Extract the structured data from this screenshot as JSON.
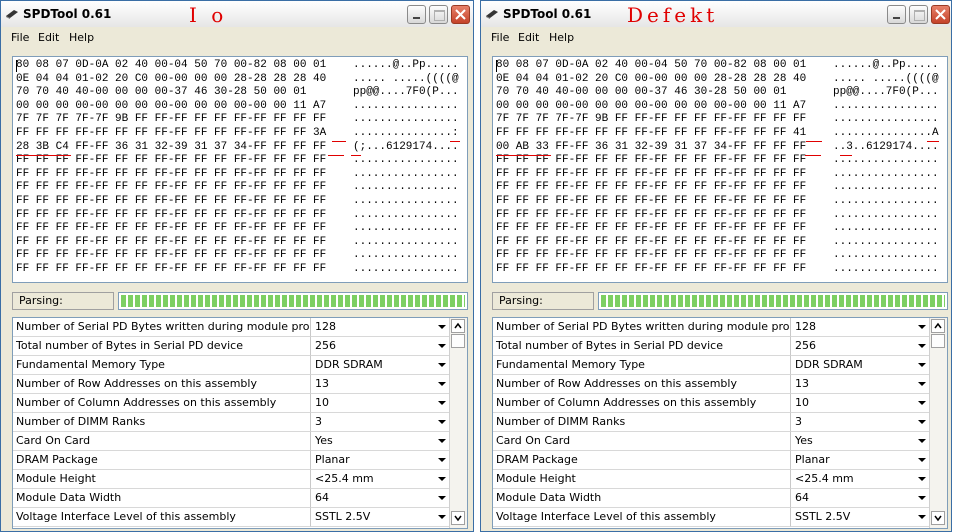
{
  "windows": [
    {
      "title": "SPDTool 0.61",
      "annotation": "I o",
      "menu": [
        "File",
        "Edit",
        "Help"
      ],
      "hex_rows": [
        {
          "hex": "80 08 07 0D-0A 02 40 00-04 50 70 00-82 08 00 01",
          "ascii": "......@..Pp....."
        },
        {
          "hex": "0E 04 04 01-02 20 C0 00-00 00 00 28-28 28 28 40",
          "ascii": "..... .....((((@"
        },
        {
          "hex": "70 70 40 40-00 00 00 00-37 46 30-28 50 00 01",
          "ascii": "pp@@....7F0(P..."
        },
        {
          "hex": "00 00 00 00-00 00 00 00-00 00 00 00-00 00 11 A7",
          "ascii": "................"
        },
        {
          "hex": "7F 7F 7F 7F-7F 9B FF FF-FF FF FF FF-FF FF FF FF",
          "ascii": "................"
        },
        {
          "hex": "FF FF FF FF-FF FF FF FF-FF FF FF FF-FF FF FF 3A",
          "ascii": "...............:"
        },
        {
          "hex": "28 3B C4 FF-FF 36 31 32-39 31 37 34-FF FF FF FF",
          "ascii": "(;...6129174...."
        },
        {
          "hex": "FF FF FF FF-FF FF FF FF-FF FF FF FF-FF FF FF FF",
          "ascii": "................"
        },
        {
          "hex": "FF FF FF FF-FF FF FF FF-FF FF FF FF-FF FF FF FF",
          "ascii": "................"
        },
        {
          "hex": "FF FF FF FF-FF FF FF FF-FF FF FF FF-FF FF FF FF",
          "ascii": "................"
        },
        {
          "hex": "FF FF FF FF-FF FF FF FF-FF FF FF FF-FF FF FF FF",
          "ascii": "................"
        },
        {
          "hex": "FF FF FF FF-FF FF FF FF-FF FF FF FF-FF FF FF FF",
          "ascii": "................"
        },
        {
          "hex": "FF FF FF FF-FF FF FF FF-FF FF FF FF-FF FF FF FF",
          "ascii": "................"
        },
        {
          "hex": "FF FF FF FF-FF FF FF FF-FF FF FF FF-FF FF FF FF",
          "ascii": "................"
        },
        {
          "hex": "FF FF FF FF-FF FF FF FF-FF FF FF FF-FF FF FF FF",
          "ascii": "................"
        },
        {
          "hex": "FF FF FF FF-FF FF FF FF-FF FF FF FF-FF FF FF FF",
          "ascii": "................"
        }
      ],
      "parsing_label": "Parsing:",
      "parsing_progress": 1.0,
      "fields": [
        {
          "name": "Number of Serial PD Bytes written during module production",
          "value": "128"
        },
        {
          "name": "Total number of Bytes in Serial PD device",
          "value": "256"
        },
        {
          "name": "Fundamental Memory Type",
          "value": "DDR SDRAM"
        },
        {
          "name": "Number of Row Addresses on this assembly",
          "value": "13"
        },
        {
          "name": "Number of Column Addresses on this assembly",
          "value": "10"
        },
        {
          "name": "Number of DIMM Ranks",
          "value": "3"
        },
        {
          "name": "Card On Card",
          "value": "Yes"
        },
        {
          "name": "DRAM Package",
          "value": "Planar"
        },
        {
          "name": "Module Height",
          "value": "<25.4 mm"
        },
        {
          "name": "Module Data Width",
          "value": "64"
        },
        {
          "name": "Voltage Interface Level of this assembly",
          "value": "SSTL 2.5V"
        }
      ]
    },
    {
      "title": "SPDTool 0.61",
      "annotation": "Defekt",
      "menu": [
        "File",
        "Edit",
        "Help"
      ],
      "hex_rows": [
        {
          "hex": "80 08 07 0D-0A 02 40 00-04 50 70 00-82 08 00 01",
          "ascii": "......@..Pp....."
        },
        {
          "hex": "0E 04 04 01-02 20 C0 00-00 00 00 28-28 28 28 40",
          "ascii": "..... .....((((@"
        },
        {
          "hex": "70 70 40 40-00 00 00 00-37 46 30-28 50 00 01",
          "ascii": "pp@@....7F0(P..."
        },
        {
          "hex": "00 00 00 00-00 00 00 00-00 00 00 00-00 00 11 A7",
          "ascii": "................"
        },
        {
          "hex": "7F 7F 7F 7F-7F 9B FF FF-FF FF FF FF-FF FF FF FF",
          "ascii": "................"
        },
        {
          "hex": "FF FF FF FF-FF FF FF FF-FF FF FF FF-FF FF FF 41",
          "ascii": "...............A"
        },
        {
          "hex": "00 AB 33 FF-FF 36 31 32-39 31 37 34-FF FF FF FF",
          "ascii": "..3..6129174...."
        },
        {
          "hex": "FF FF FF FF-FF FF FF FF-FF FF FF FF-FF FF FF FF",
          "ascii": "................"
        },
        {
          "hex": "FF FF FF FF-FF FF FF FF-FF FF FF FF-FF FF FF FF",
          "ascii": "................"
        },
        {
          "hex": "FF FF FF FF-FF FF FF FF-FF FF FF FF-FF FF FF FF",
          "ascii": "................"
        },
        {
          "hex": "FF FF FF FF-FF FF FF FF-FF FF FF FF-FF FF FF FF",
          "ascii": "................"
        },
        {
          "hex": "FF FF FF FF-FF FF FF FF-FF FF FF FF-FF FF FF FF",
          "ascii": "................"
        },
        {
          "hex": "FF FF FF FF-FF FF FF FF-FF FF FF FF-FF FF FF FF",
          "ascii": "................"
        },
        {
          "hex": "FF FF FF FF-FF FF FF FF-FF FF FF FF-FF FF FF FF",
          "ascii": "................"
        },
        {
          "hex": "FF FF FF FF-FF FF FF FF-FF FF FF FF-FF FF FF FF",
          "ascii": "................"
        },
        {
          "hex": "FF FF FF FF-FF FF FF FF-FF FF FF FF-FF FF FF FF",
          "ascii": "................"
        }
      ],
      "parsing_label": "Parsing:",
      "parsing_progress": 1.0,
      "fields": [
        {
          "name": "Number of Serial PD Bytes written during module production",
          "value": "128"
        },
        {
          "name": "Total number of Bytes in Serial PD device",
          "value": "256"
        },
        {
          "name": "Fundamental Memory Type",
          "value": "DDR SDRAM"
        },
        {
          "name": "Number of Row Addresses on this assembly",
          "value": "13"
        },
        {
          "name": "Number of Column Addresses on this assembly",
          "value": "10"
        },
        {
          "name": "Number of DIMM Ranks",
          "value": "3"
        },
        {
          "name": "Card On Card",
          "value": "Yes"
        },
        {
          "name": "DRAM Package",
          "value": "Planar"
        },
        {
          "name": "Module Height",
          "value": "<25.4 mm"
        },
        {
          "name": "Module Data Width",
          "value": "64"
        },
        {
          "name": "Voltage Interface Level of this assembly",
          "value": "SSTL 2.5V"
        }
      ]
    }
  ],
  "colors": {
    "annotation": "#e00000",
    "progress_fill": "#7ccf62",
    "window_border": "#3a6ea5"
  },
  "icons": [
    "app-icon",
    "minimize-icon",
    "maximize-icon",
    "close-icon",
    "chevron-down-icon",
    "scroll-up-icon",
    "scroll-down-icon"
  ]
}
